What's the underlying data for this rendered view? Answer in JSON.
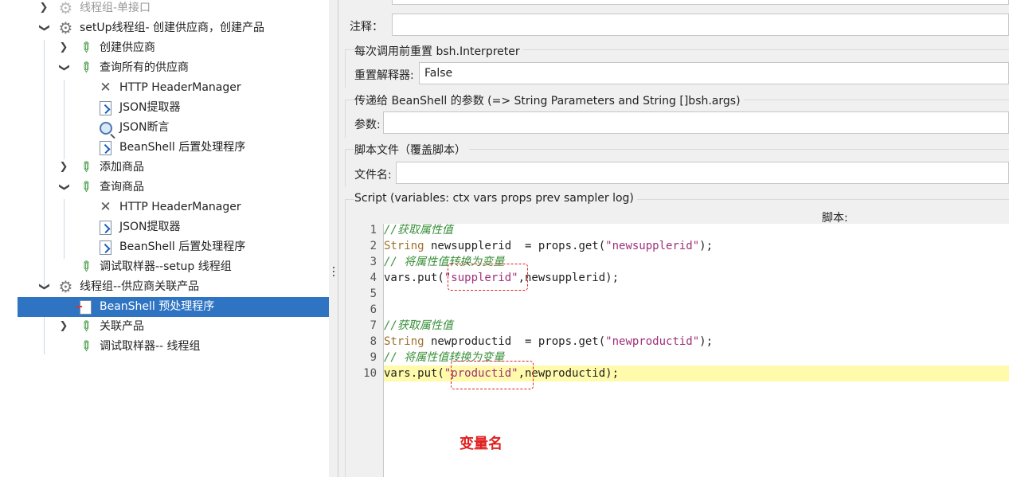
{
  "tree": {
    "items": [
      {
        "label": "线程组-单接口",
        "icon": "gear-icon"
      },
      {
        "label": "setUp线程组- 创建供应商，创建产品",
        "icon": "gear-icon"
      },
      {
        "label": "创建供应商",
        "icon": "sampler-dropper-icon"
      },
      {
        "label": "查询所有的供应商",
        "icon": "sampler-dropper-icon"
      },
      {
        "label": "HTTP HeaderManager",
        "icon": "wrench-icon"
      },
      {
        "label": "JSON提取器",
        "icon": "postprocessor-icon"
      },
      {
        "label": "JSON断言",
        "icon": "magnifier-icon"
      },
      {
        "label": "BeanShell 后置处理程序",
        "icon": "postprocessor-icon"
      },
      {
        "label": "添加商品",
        "icon": "sampler-dropper-icon"
      },
      {
        "label": "查询商品",
        "icon": "sampler-dropper-icon"
      },
      {
        "label": "HTTP HeaderManager",
        "icon": "wrench-icon"
      },
      {
        "label": "JSON提取器",
        "icon": "postprocessor-icon"
      },
      {
        "label": "BeanShell 后置处理程序",
        "icon": "postprocessor-icon"
      },
      {
        "label": "调试取样器--setup 线程组",
        "icon": "sampler-dropper-icon"
      },
      {
        "label": "线程组--供应商关联产品",
        "icon": "gear-icon"
      },
      {
        "label": "BeanShell 预处理程序",
        "icon": "preprocessor-icon"
      },
      {
        "label": "关联产品",
        "icon": "sampler-dropper-icon"
      },
      {
        "label": "调试取样器-- 线程组",
        "icon": "sampler-dropper-icon"
      }
    ]
  },
  "form": {
    "comment_label": "注释：",
    "comment_value": "",
    "reset_group_title": "每次调用前重置 bsh.Interpreter",
    "reset_label": "重置解释器:",
    "reset_value": "False",
    "params_group_title": "传递给 BeanShell 的参数 (=> String Parameters and String []bsh.args)",
    "params_label": "参数:",
    "params_value": "",
    "file_group_title": "脚本文件（覆盖脚本）",
    "file_label": "文件名:",
    "file_value": "",
    "script_group_title": "Script (variables: ctx vars props prev sampler log)",
    "script_label": "脚本:"
  },
  "code": {
    "line_numbers": [
      "1",
      "2",
      "3",
      "4",
      "5",
      "6",
      "7",
      "8",
      "9",
      "10"
    ],
    "l1": "//获取属性值",
    "l2_type": "String",
    "l2_mid": " newsupplerid  = props.get(",
    "l2_str": "\"newsupplerid\"",
    "l2_end": ");",
    "l3": "// 将属性值转换为变量",
    "l4_start": "vars.put(",
    "l4_str": "\"supplerid\"",
    "l4_end": ",newsupplerid);",
    "l7": "//获取属性值",
    "l8_type": "String",
    "l8_mid": " newproductid  = props.get(",
    "l8_str": "\"newproductid\"",
    "l8_end": ");",
    "l9": "// 将属性值转换为变量",
    "l10_start": "vars.put(",
    "l10_str": "\"productid\"",
    "l10_end": ",newproductid);",
    "annotation": "变量名"
  },
  "colors": {
    "selection": "#2f74c2",
    "highlight_line": "#fffbaa",
    "annotation_red": "#e02020"
  }
}
